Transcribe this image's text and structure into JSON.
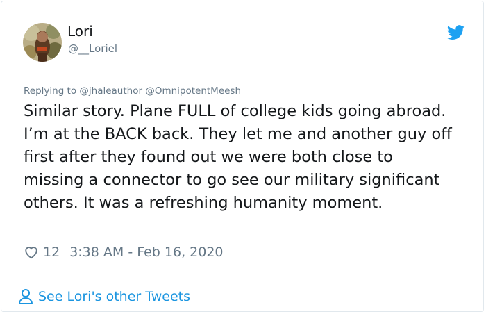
{
  "user": {
    "name": "Lori",
    "handle": "@__Loriel"
  },
  "tweet": {
    "replying_to": "Replying to @jhaleauthor @OmnipotentMeesh",
    "text": "Similar story. Plane FULL of college kids going abroad. I’m at the BACK back. They let me and another guy off first after they found out we were both close to missing a connector to go see our military significant others. It was a refreshing humanity moment.",
    "like_count": "12",
    "timestamp": "3:38 AM - Feb 16, 2020"
  },
  "footer": {
    "link_label": "See Lori's other Tweets"
  },
  "icons": {
    "brand": "twitter-bird-icon",
    "like": "heart-icon",
    "profile": "person-icon"
  },
  "colors": {
    "brand_blue": "#1da1f2",
    "link_blue": "#1b95e0",
    "secondary_text": "#657786",
    "border": "#e1e8ed"
  }
}
